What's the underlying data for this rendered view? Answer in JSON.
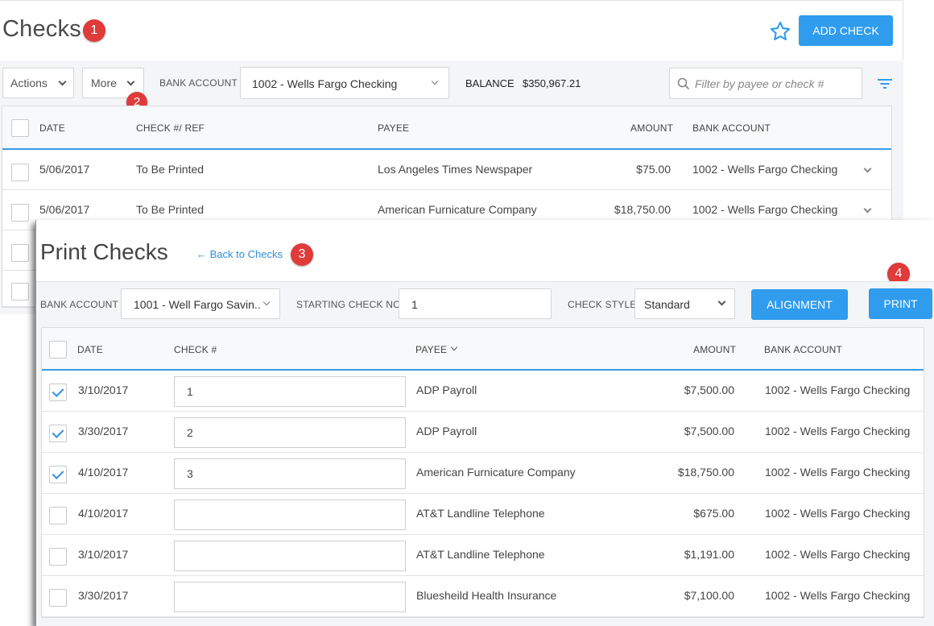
{
  "checks_page": {
    "title": "Checks",
    "badge1": "1",
    "badge2": "2",
    "add_check_label": "ADD CHECK",
    "actions_label": "Actions",
    "more_label": "More",
    "bank_account_label": "BANK ACCOUNT",
    "bank_account_value": "1002 - Wells Fargo Checking",
    "balance_label": "BALANCE",
    "balance_value": "$350,967.21",
    "search_placeholder": "Filter by payee or check #",
    "columns": [
      "DATE",
      "CHECK #/ REF",
      "PAYEE",
      "AMOUNT",
      "BANK ACCOUNT"
    ],
    "rows": [
      {
        "date": "5/06/2017",
        "ref": "To Be Printed",
        "payee": "Los Angeles Times Newspaper",
        "amount": "$75.00",
        "account": "1002 - Wells Fargo Checking"
      },
      {
        "date": "5/06/2017",
        "ref": "To Be Printed",
        "payee": "American Furnicature Company",
        "amount": "$18,750.00",
        "account": "1002 - Wells Fargo Checking"
      }
    ]
  },
  "print_checks": {
    "title": "Print Checks",
    "back_link": "Back to Checks",
    "badge3": "3",
    "badge4": "4",
    "bank_account_label": "BANK ACCOUNT",
    "bank_account_value": "1001 - Well Fargo Savin..",
    "starting_check_label": "STARTING CHECK NO",
    "starting_check_value": "1",
    "check_style_label": "CHECK STYLE",
    "check_style_value": "Standard",
    "alignment_label": "ALIGNMENT",
    "print_label": "PRINT",
    "columns": [
      "DATE",
      "CHECK #",
      "PAYEE",
      "AMOUNT",
      "BANK ACCOUNT"
    ],
    "rows": [
      {
        "checked": true,
        "date": "3/10/2017",
        "check_no": "1",
        "payee": "ADP Payroll",
        "amount": "$7,500.00",
        "account": "1002 - Wells Fargo Checking"
      },
      {
        "checked": true,
        "date": "3/30/2017",
        "check_no": "2",
        "payee": "ADP Payroll",
        "amount": "$7,500.00",
        "account": "1002 - Wells Fargo Checking"
      },
      {
        "checked": true,
        "date": "4/10/2017",
        "check_no": "3",
        "payee": "American Furnicature Company",
        "amount": "$18,750.00",
        "account": "1002 - Wells Fargo Checking"
      },
      {
        "checked": false,
        "date": "4/10/2017",
        "check_no": "",
        "payee": "AT&T Landline Telephone",
        "amount": "$675.00",
        "account": "1002 - Wells Fargo Checking"
      },
      {
        "checked": false,
        "date": "3/10/2017",
        "check_no": "",
        "payee": "AT&T Landline Telephone",
        "amount": "$1,191.00",
        "account": "1002 - Wells Fargo Checking"
      },
      {
        "checked": false,
        "date": "3/30/2017",
        "check_no": "",
        "payee": "Bluesheild Health Insurance",
        "amount": "$7,100.00",
        "account": "1002 - Wells Fargo Checking"
      }
    ]
  },
  "colors": {
    "accent": "#2f9cee",
    "badge": "#e03a3a"
  }
}
